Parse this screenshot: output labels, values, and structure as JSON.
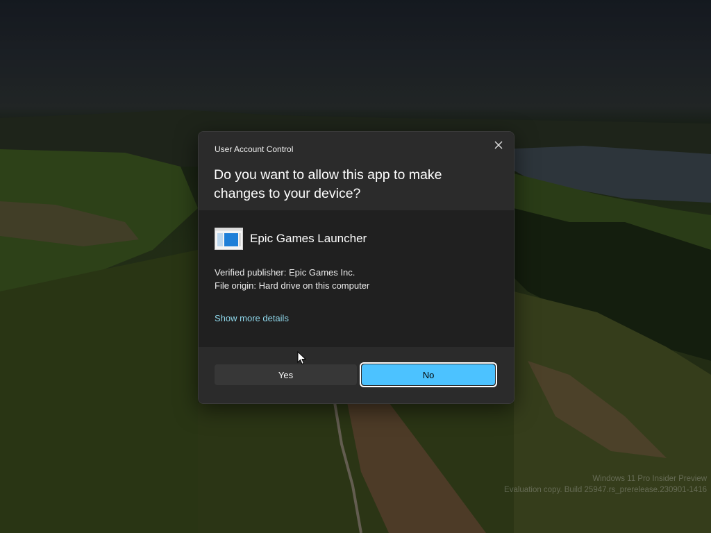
{
  "dialog": {
    "title": "User Account Control",
    "question": "Do you want to allow this app to make changes to your device?",
    "close_icon": "close-icon",
    "app": {
      "name": "Epic Games Launcher",
      "icon": "app-window-icon"
    },
    "publisher_line": "Verified publisher: Epic Games Inc.",
    "origin_line": "File origin: Hard drive on this computer",
    "more_details_link": "Show more details",
    "buttons": {
      "yes": "Yes",
      "no": "No"
    },
    "colors": {
      "accent": "#4cc2ff",
      "link": "#8fd8ec",
      "dialog_bg": "#202020",
      "header_bg": "#2b2b2b"
    }
  },
  "watermark": {
    "line1": "Windows 11 Pro Insider Preview",
    "line2": "Evaluation copy. Build 25947.rs_prerelease.230901-1416"
  }
}
